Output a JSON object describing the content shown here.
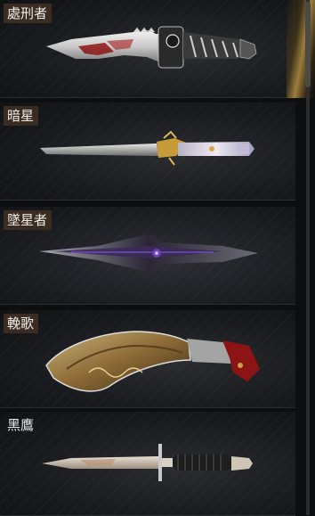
{
  "weapons": [
    {
      "name": "處刑者",
      "icon": "tactical-serrated-knife"
    },
    {
      "name": "暗星",
      "icon": "slim-gold-hilt-knife"
    },
    {
      "name": "墜星者",
      "icon": "dark-purple-blade"
    },
    {
      "name": "輓歌",
      "icon": "ornate-kukri"
    },
    {
      "name": "黑鷹",
      "icon": "combat-knife"
    }
  ],
  "colors": {
    "label_bg": "#3a2c22",
    "card_bg": "#1a1b1e",
    "accent_gold": "#c9a24a",
    "accent_red": "#8d1414",
    "accent_purple": "#6a3fb0"
  }
}
